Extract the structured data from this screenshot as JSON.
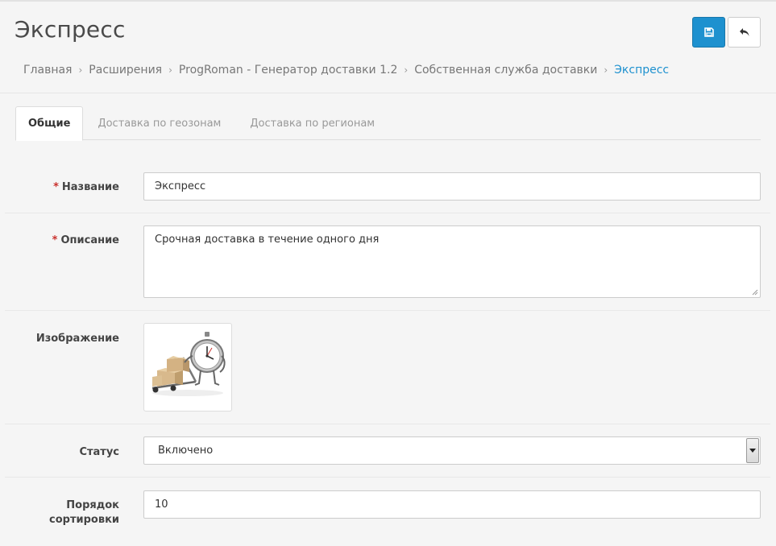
{
  "header": {
    "title": "Экспресс",
    "save_icon": "floppy-disk-icon",
    "back_icon": "reply-arrow-icon"
  },
  "breadcrumb": {
    "items": [
      "Главная",
      "Расширения",
      "ProgRoman - Генератор доставки 1.2",
      "Собственная служба доставки",
      "Экспресс"
    ],
    "separator": "›"
  },
  "tabs": [
    {
      "label": "Общие",
      "active": true
    },
    {
      "label": "Доставка по геозонам",
      "active": false
    },
    {
      "label": "Доставка по регионам",
      "active": false
    }
  ],
  "form": {
    "name": {
      "label": "Название",
      "required": "*",
      "value": "Экспресс"
    },
    "description": {
      "label": "Описание",
      "required": "*",
      "value": "Срочная доставка в течение одного дня"
    },
    "image": {
      "label": "Изображение",
      "icon": "delivery-stopwatch-image"
    },
    "status": {
      "label": "Статус",
      "value": "Включено"
    },
    "sort_order": {
      "label_line1": "Порядок",
      "label_line2": "сортировки",
      "value": "10"
    }
  },
  "colors": {
    "primary": "#1e91cf",
    "required": "#c9302c",
    "background": "#f5f5f5"
  }
}
